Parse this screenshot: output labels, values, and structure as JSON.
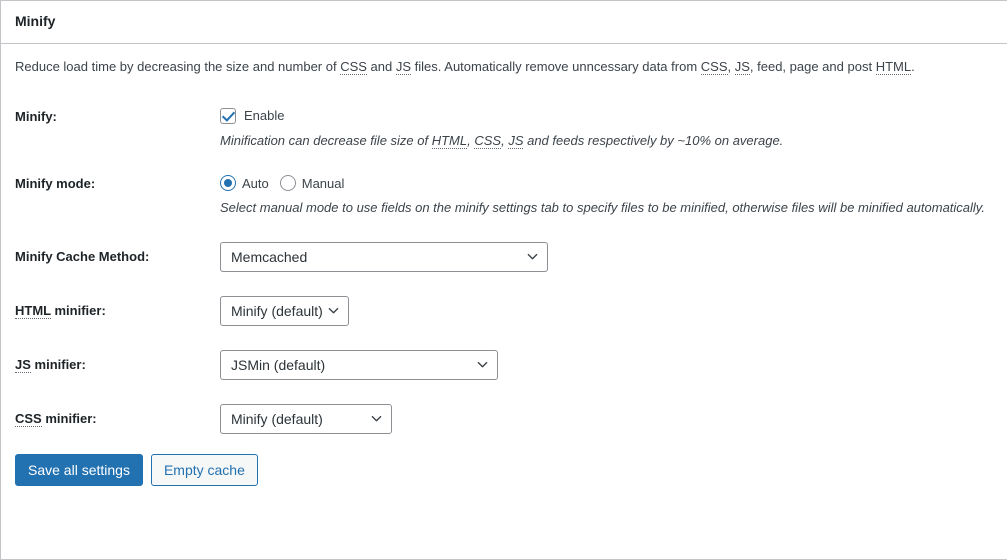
{
  "panel": {
    "title": "Minify",
    "intro": "Reduce load time by decreasing the size and number of CSS and JS files. Automatically remove unncessary data from CSS, JS, feed, page and post HTML."
  },
  "intro_parts": {
    "p1": "Reduce load time by decreasing the size and number of ",
    "css1": "CSS",
    "p2": " and ",
    "js1": "JS",
    "p3": " files. Automatically remove unncessary data from ",
    "css2": "CSS",
    "p4": ", ",
    "js2": "JS",
    "p5": ", feed, page and post ",
    "html1": "HTML",
    "p6": "."
  },
  "rows": {
    "minify": {
      "label": "Minify:",
      "checkbox_label": "Enable",
      "checked": true,
      "description": "Minification can decrease file size of HTML, CSS, JS and feeds respectively by ~10% on average.",
      "desc_parts": {
        "d1": "Minification can decrease file size of ",
        "html": "HTML",
        "d2": ", ",
        "css": "CSS",
        "d3": ", ",
        "js": "JS",
        "d4": " and feeds respectively by ~10% on average."
      }
    },
    "minify_mode": {
      "label": "Minify mode:",
      "options": [
        {
          "label": "Auto",
          "selected": true
        },
        {
          "label": "Manual",
          "selected": false
        }
      ],
      "description": "Select manual mode to use fields on the minify settings tab to specify files to be minified, otherwise files will be minified automatically."
    },
    "cache_method": {
      "label": "Minify Cache Method:",
      "value": "Memcached"
    },
    "html_minifier": {
      "label": "HTML minifier:",
      "label_acronym": "HTML",
      "label_rest": " minifier:",
      "value": "Minify (default)"
    },
    "js_minifier": {
      "label": "JS minifier:",
      "label_acronym": "JS",
      "label_rest": " minifier:",
      "value": "JSMin (default)"
    },
    "css_minifier": {
      "label": "CSS minifier:",
      "label_acronym": "CSS",
      "label_rest": " minifier:",
      "value": "Minify (default)"
    }
  },
  "buttons": {
    "save": "Save all settings",
    "empty_cache": "Empty cache"
  },
  "colors": {
    "accent": "#2271b1",
    "panel_border": "#c3c4c7",
    "text": "#3c434a",
    "heading": "#1d2327",
    "field_border": "#8c8f94"
  },
  "icons": {
    "chevron_down": "chevron-down-icon",
    "checkmark": "checkmark-icon"
  }
}
